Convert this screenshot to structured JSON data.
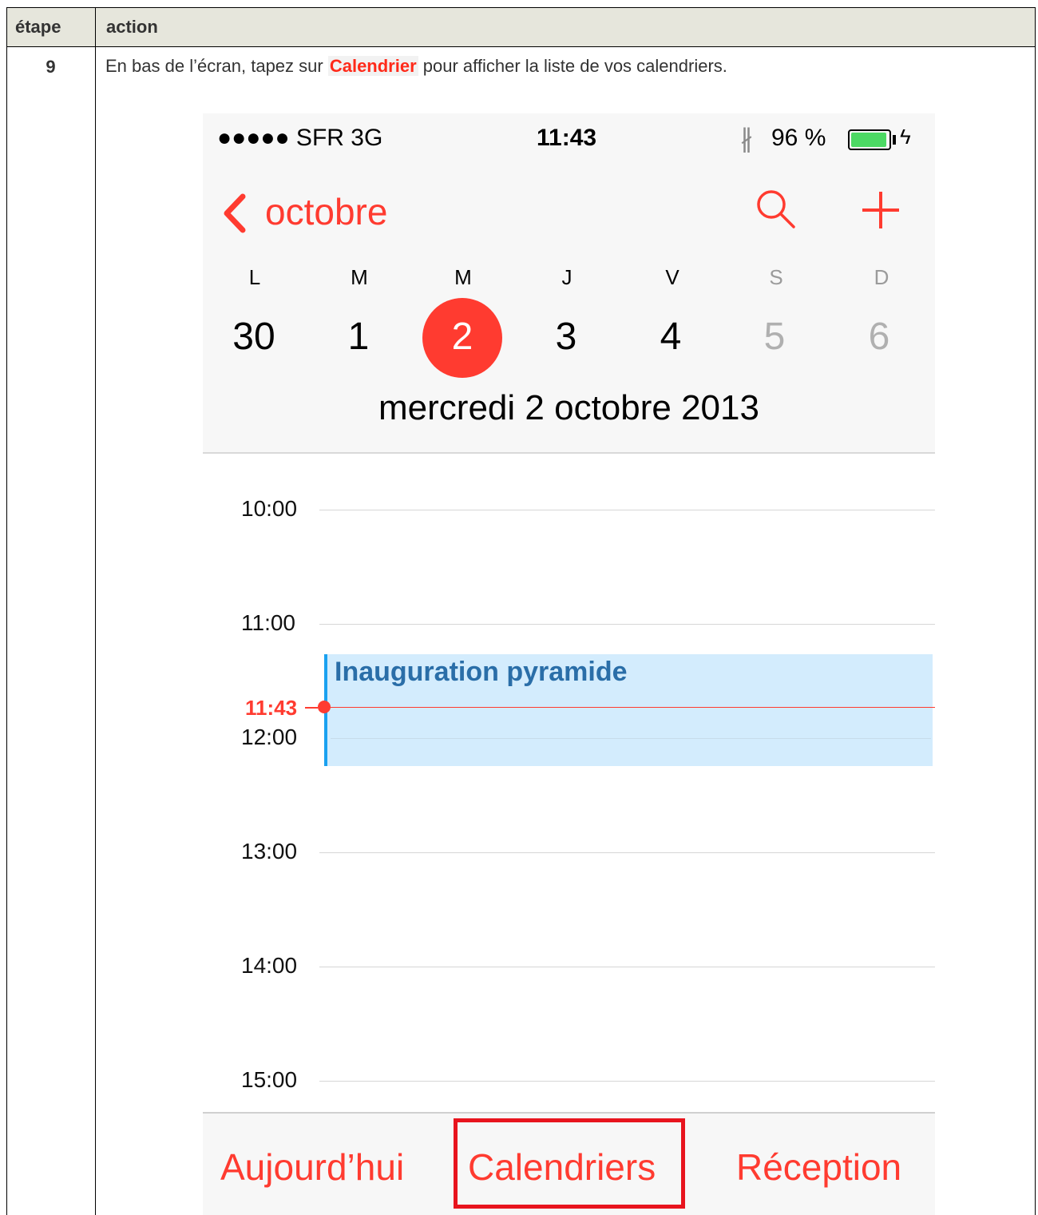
{
  "table": {
    "header_step": "étape",
    "header_action": "action",
    "step_number": "9",
    "instruction_before": "En bas de l’écran, tapez sur ",
    "instruction_highlight": "Calendrier",
    "instruction_after": " pour afficher la liste de vos calendriers."
  },
  "phone": {
    "status": {
      "carrier": "●●●●● SFR   3G",
      "time": "11:43",
      "bluetooth": "∦",
      "battery_percent": "96 %",
      "battery_level": 0.96
    },
    "nav": {
      "back_label": "octobre"
    },
    "week": {
      "days_of_week": [
        "L",
        "M",
        "M",
        "J",
        "V",
        "S",
        "D"
      ],
      "dates": [
        "30",
        "1",
        "2",
        "3",
        "4",
        "5",
        "6"
      ],
      "selected_date": "2"
    },
    "selected_date_label": "mercredi  2 octobre 2013",
    "hours": [
      "10:00",
      "11:00",
      "12:00",
      "13:00",
      "14:00",
      "15:00"
    ],
    "event": {
      "title": "Inauguration pyramide"
    },
    "now_time": "11:43",
    "toolbar": {
      "today": "Aujourd’hui",
      "calendars": "Calendriers",
      "inbox": "Réception"
    }
  },
  "colors": {
    "accent": "#ff3b30",
    "event_bg": "#d3ecfd",
    "event_text": "#2a6ea8",
    "highlight_box": "#e8141e"
  }
}
